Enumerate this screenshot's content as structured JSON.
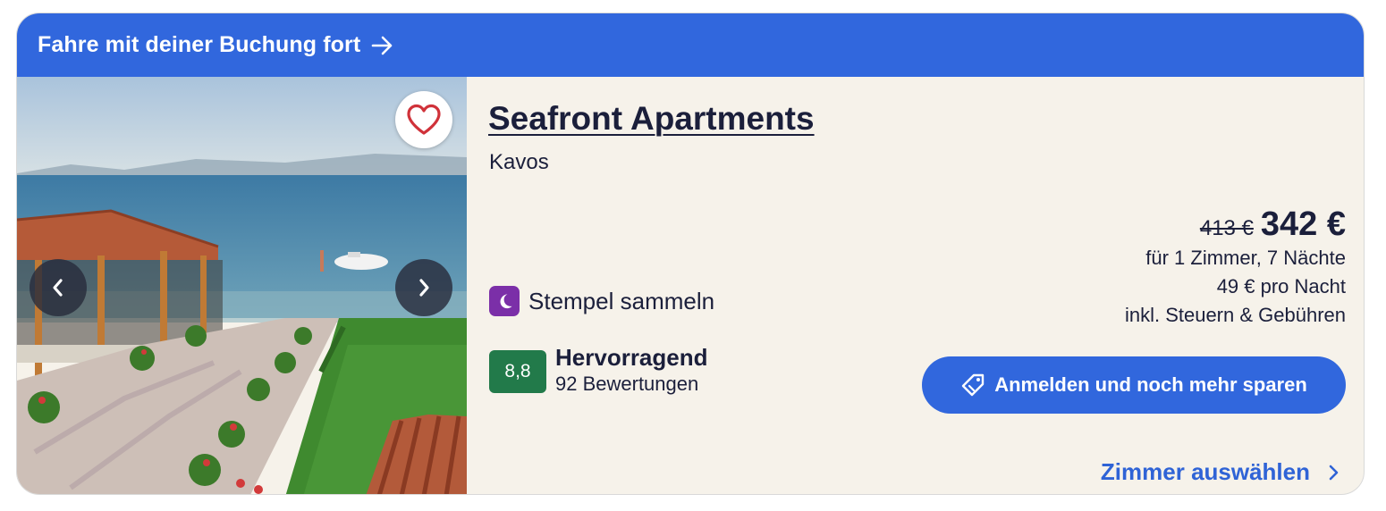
{
  "banner": {
    "text": "Fahre mit deiner Buchung fort",
    "icon": "arrow-right-icon",
    "color": "#3167dd"
  },
  "gallery": {
    "favorite_icon": "heart-icon",
    "prev_icon": "chevron-left-icon",
    "next_icon": "chevron-right-icon"
  },
  "hotel": {
    "name": "Seafront Apartments",
    "location": "Kavos"
  },
  "stamp": {
    "label": "Stempel sammeln",
    "icon": "moon-icon",
    "color": "#7b2fa8"
  },
  "rating": {
    "score": "8,8",
    "label": "Hervorragend",
    "count": "92 Bewertungen",
    "color": "#227a4a"
  },
  "price": {
    "old": "413 €",
    "current": "342 €",
    "details": "für 1 Zimmer, 7 Nächte",
    "per_night": "49 € pro Nacht",
    "taxes": "inkl. Steuern & Gebühren"
  },
  "actions": {
    "login_label": "Anmelden und noch mehr sparen",
    "login_icon": "tag-icon",
    "select_room_label": "Zimmer auswählen",
    "select_room_icon": "chevron-right-icon",
    "accent_color": "#2f63d6"
  }
}
